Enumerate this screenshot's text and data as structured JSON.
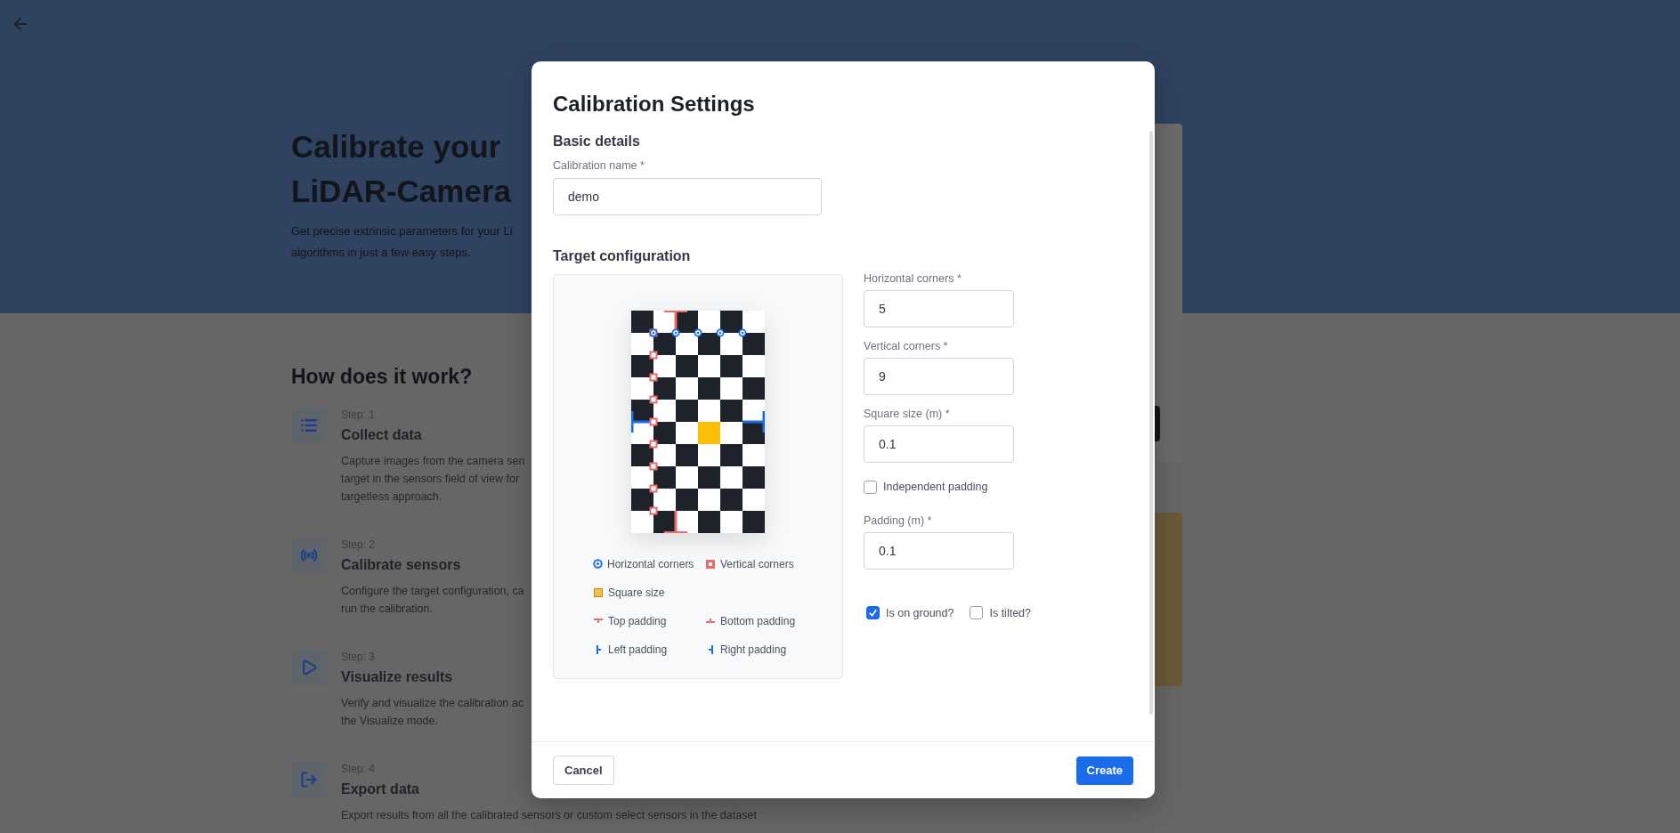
{
  "page": {
    "title_lines": [
      "Calibrate your",
      "LiDAR-Camera"
    ],
    "intro_lines": [
      "Get precise extrinsic parameters for your Li",
      "algorithms in just a few easy steps."
    ],
    "how_title": "How does it work?",
    "steps": [
      {
        "kind": "list",
        "step": "Step: 1",
        "title": "Collect data",
        "lines": [
          "Capture images from the camera sen",
          "target in the sensors field of view for",
          "targetless approach."
        ]
      },
      {
        "kind": "signal",
        "step": "Step: 2",
        "title": "Calibrate sensors",
        "lines": [
          "Configure the target configuration, ca",
          "run the calibration."
        ]
      },
      {
        "kind": "play",
        "step": "Step: 3",
        "title": "Visualize results",
        "lines": [
          "Verify and visualize the calibration ac",
          "the Visualize mode."
        ]
      },
      {
        "kind": "export",
        "step": "Step: 4",
        "title": "Export data",
        "lines": [
          "Export results from all the calibrated sensors or custom select sensors in the dataset"
        ]
      }
    ]
  },
  "dialog": {
    "title": "Calibration Settings",
    "basic": {
      "heading": "Basic details",
      "label": "Calibration name *",
      "value": "demo"
    },
    "target": {
      "heading": "Target configuration",
      "legend": [
        {
          "kind": "horizontal",
          "label": "Horizontal corners"
        },
        {
          "kind": "vertical",
          "label": "Vertical corners"
        },
        {
          "kind": "square",
          "label": "Square size"
        },
        {
          "kind": "top",
          "label": "Top padding"
        },
        {
          "kind": "bottom",
          "label": "Bottom padding"
        },
        {
          "kind": "left",
          "label": "Left padding"
        },
        {
          "kind": "right",
          "label": "Right padding"
        }
      ],
      "fields": [
        {
          "kind": "input",
          "label": "Horizontal corners *",
          "value": "5"
        },
        {
          "kind": "input",
          "label": "Vertical corners *",
          "value": "9"
        },
        {
          "kind": "input",
          "label": "Square size (m) *",
          "value": "0.1"
        },
        {
          "kind": "checkbox",
          "label": "Independent padding",
          "checked": false
        },
        {
          "kind": "input",
          "label": "Padding (m) *",
          "value": "0.1"
        }
      ],
      "options": [
        {
          "label": "Is on ground?",
          "checked": true
        },
        {
          "label": "Is tilted?",
          "checked": false
        }
      ]
    },
    "buttons": {
      "cancel": "Cancel",
      "create": "Create"
    }
  }
}
